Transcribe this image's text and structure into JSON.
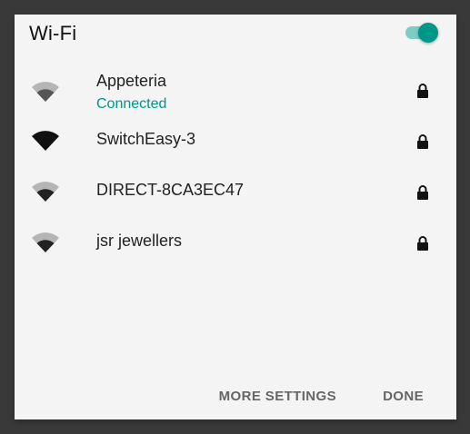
{
  "header": {
    "title": "Wi-Fi",
    "toggle_on": true
  },
  "networks": [
    {
      "name": "Appeteria",
      "status": "Connected",
      "icon": "wifi-signal-medium-icon",
      "secured": true
    },
    {
      "name": "SwitchEasy-3",
      "status": "",
      "icon": "wifi-signal-full-icon",
      "secured": true
    },
    {
      "name": "DIRECT-8CA3EC47",
      "status": "",
      "icon": "wifi-signal-medium-icon",
      "secured": true
    },
    {
      "name": "jsr jewellers",
      "status": "",
      "icon": "wifi-signal-medium-icon",
      "secured": true
    }
  ],
  "actions": {
    "more_settings": "MORE SETTINGS",
    "done": "DONE"
  },
  "colors": {
    "accent": "#009688",
    "accent_track": "#80cbc4",
    "background": "#f4f4f4",
    "frame": "#393939"
  }
}
